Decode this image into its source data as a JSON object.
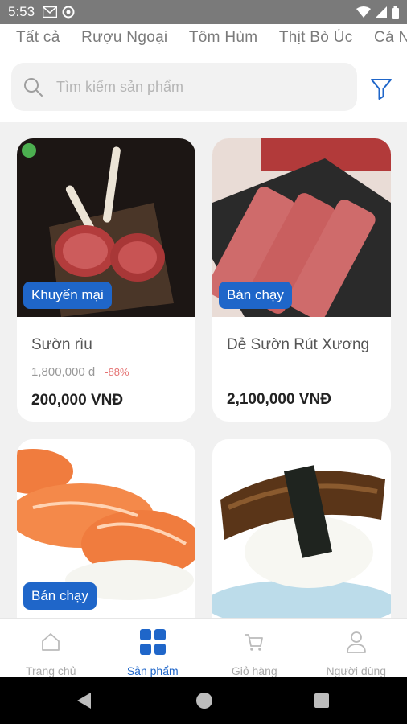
{
  "status_bar": {
    "time": "5:53"
  },
  "categories": [
    "Tất cả",
    "Rượu Ngoại",
    "Tôm Hùm",
    "Thịt Bò Úc",
    "Cá N"
  ],
  "search": {
    "placeholder": "Tìm kiếm sản phẩm"
  },
  "products": [
    {
      "badge": "Khuyến mại",
      "name": "Sườn rìu",
      "old_price": "1,800,000 đ",
      "discount": "-88%",
      "price": "200,000 VNĐ"
    },
    {
      "badge": "Bán chạy",
      "name": "Dẻ Sườn Rút Xương",
      "price": "2,100,000 VNĐ"
    },
    {
      "badge": "Bán chạy"
    },
    {}
  ],
  "bottom_nav": [
    {
      "label": "Trang chủ",
      "icon": "home-icon"
    },
    {
      "label": "Sản phẩm",
      "icon": "grid-icon",
      "active": true
    },
    {
      "label": "Giỏ hàng",
      "icon": "cart-icon"
    },
    {
      "label": "Người dùng",
      "icon": "user-icon"
    }
  ],
  "colors": {
    "accent": "#1f66c9",
    "discount": "#e57373"
  }
}
